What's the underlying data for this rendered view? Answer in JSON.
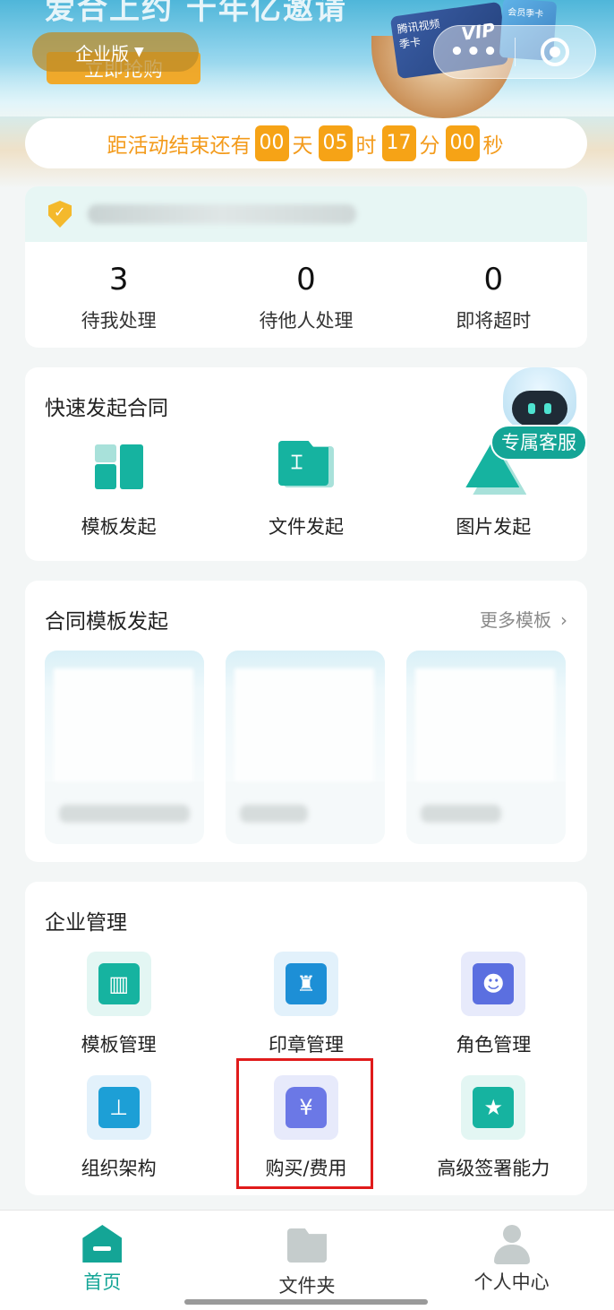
{
  "banner": {
    "headline": "爱合上约 十年亿邀请",
    "edition": "企业版",
    "grab": "立即抢购",
    "card_brand": "腾讯视频",
    "card_vip": "VIP",
    "card_season": "季卡",
    "card2_label": "会员季卡",
    "capsule_more": "•••"
  },
  "countdown": {
    "prefix": "距活动结束还有",
    "days": "00",
    "days_unit": "天",
    "hours": "05",
    "hours_unit": "时",
    "minutes": "17",
    "minutes_unit": "分",
    "seconds": "00",
    "seconds_unit": "秒"
  },
  "tasks": {
    "stats": [
      {
        "value": "3",
        "label": "待我处理"
      },
      {
        "value": "0",
        "label": "待他人处理"
      },
      {
        "value": "0",
        "label": "即将超时"
      }
    ]
  },
  "quick": {
    "title": "快速发起合同",
    "items": [
      {
        "label": "模板发起",
        "icon": "template-icon"
      },
      {
        "label": "文件发起",
        "icon": "file-icon"
      },
      {
        "label": "图片发起",
        "icon": "image-icon"
      }
    ],
    "service_label": "专属客服"
  },
  "templates": {
    "title": "合同模板发起",
    "more": "更多模板",
    "more_arrow": "›"
  },
  "management": {
    "title": "企业管理",
    "items": [
      {
        "label": "模板管理",
        "icon": "template-manage-icon",
        "color": "#16b3a0",
        "bg": "#e3f6f3"
      },
      {
        "label": "印章管理",
        "icon": "seal-icon",
        "color": "#1d8fd6",
        "bg": "#e2f1fb"
      },
      {
        "label": "角色管理",
        "icon": "role-icon",
        "color": "#5b6fe0",
        "bg": "#e7eafb"
      },
      {
        "label": "组织架构",
        "icon": "org-icon",
        "color": "#1d9fd6",
        "bg": "#e2f1fb"
      },
      {
        "label": "购买/费用",
        "icon": "purchase-icon",
        "color": "#6b78e6",
        "bg": "#e7eafb"
      },
      {
        "label": "高级签署能力",
        "icon": "star-icon",
        "color": "#16b3a0",
        "bg": "#e3f6f3"
      }
    ]
  },
  "tabbar": {
    "items": [
      {
        "label": "首页",
        "active": true
      },
      {
        "label": "文件夹",
        "active": false
      },
      {
        "label": "个人中心",
        "active": false
      }
    ]
  },
  "colors": {
    "accent": "#14a596",
    "countdown": "#f6a316",
    "highlight": "#e01b1b"
  }
}
